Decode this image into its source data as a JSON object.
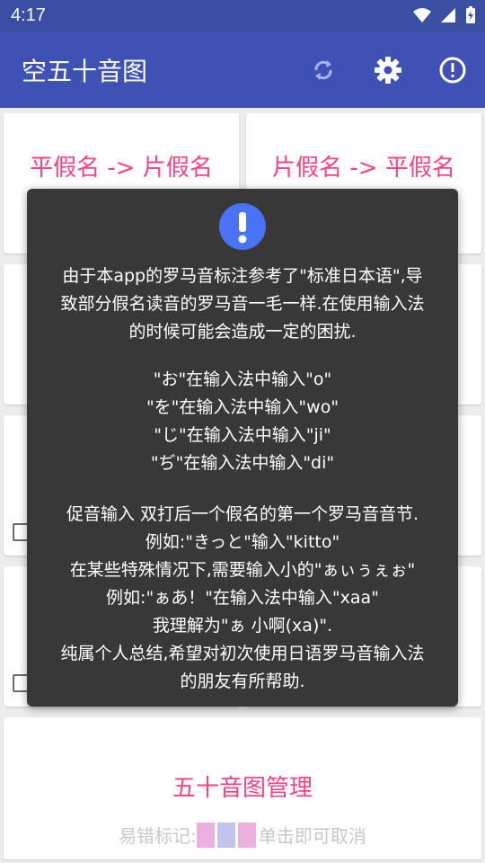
{
  "status": {
    "time": "4:17"
  },
  "app_bar": {
    "title": "空五十音图"
  },
  "cards": {
    "hira_to_kata": "平假名 -> 片假名",
    "kata_to_hira": "片假名 -> 平假名"
  },
  "management": {
    "title": "五十音图管理",
    "legend_prefix": "易错标记:",
    "legend_suffix": "单击即可取消",
    "swatch_colors": [
      "#ebb0de",
      "#c3c4eb",
      "#ebb0de"
    ]
  },
  "dialog": {
    "para1": [
      "由于本app的罗马音标注参考了\"标准日本语\",导",
      "致部分假名读音的罗马音一毛一样.在使用输入法",
      "的时候可能会造成一定的困扰."
    ],
    "para2": [
      "\"お\"在输入法中输入\"o\"",
      "\"を\"在输入法中输入\"wo\"",
      "\"じ\"在输入法中输入\"ji\"",
      "\"ぢ\"在输入法中输入\"di\""
    ],
    "para3": [
      "促音输入 双打后一个假名的第一个罗马音音节.",
      "例如:\"きっと\"输入\"kitto\"",
      "在某些特殊情况下,需要输入小的\"ぁぃぅぇぉ\"",
      "例如:\"ぁあ！\"在输入法中输入\"xaa\"",
      "我理解为\"ぁ 小啊(xa)\".",
      "纯属个人总结,希望对初次使用日语罗马音输入法",
      "的朋友有所帮助."
    ]
  },
  "colors": {
    "primary": "#3f51b5",
    "accent": "#ff3f7f",
    "dialog_bg": "#383838",
    "alert_blue": "#4a72f5"
  }
}
